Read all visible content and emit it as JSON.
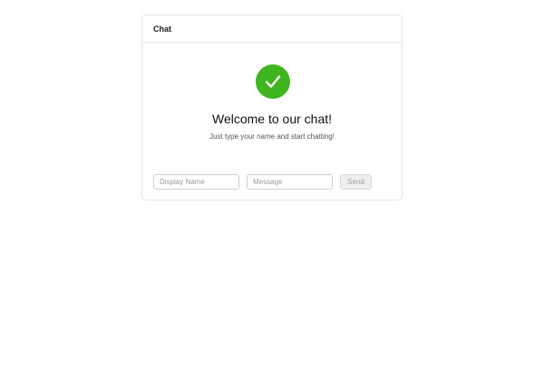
{
  "card": {
    "title": "Chat"
  },
  "welcome": {
    "icon": "check-circle-icon",
    "icon_color": "#3fb51f",
    "title": "Welcome to our chat!",
    "subtitle": "Just type your name and start chatting!"
  },
  "form": {
    "name_placeholder": "Display Name",
    "name_value": "",
    "message_placeholder": "Message",
    "message_value": "",
    "send_label": "Send"
  }
}
